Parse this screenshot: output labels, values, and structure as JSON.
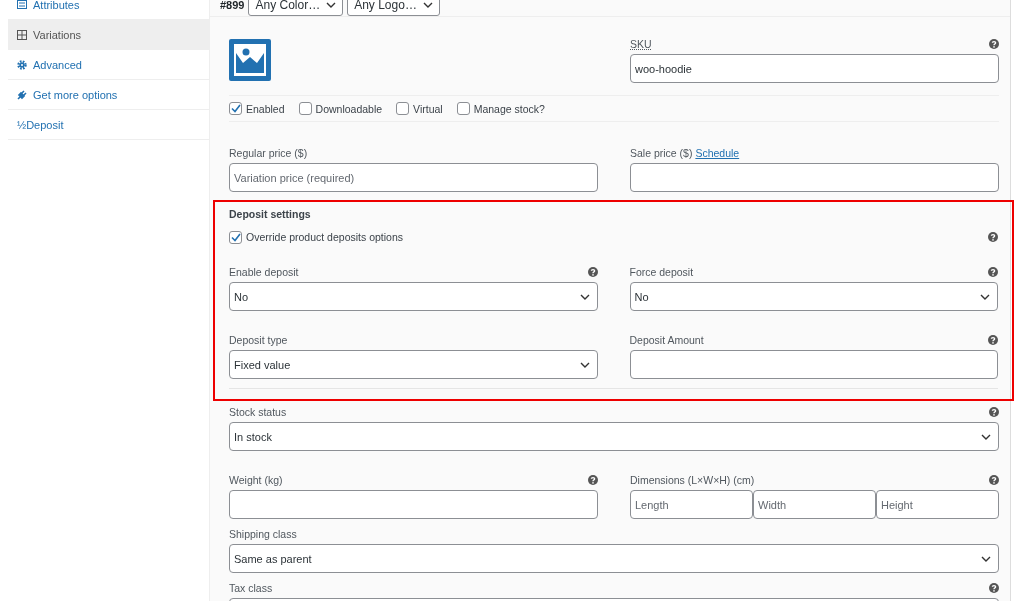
{
  "sidebar": {
    "items": [
      {
        "label": "Attributes",
        "kind": "list",
        "selected": false
      },
      {
        "label": "Variations",
        "kind": "grid",
        "selected": true
      },
      {
        "label": "Advanced",
        "kind": "gear",
        "selected": false
      },
      {
        "label": "Get more options",
        "kind": "plug",
        "selected": false
      },
      {
        "label": "½Deposit",
        "kind": "none",
        "selected": false
      }
    ]
  },
  "variation": {
    "number": "#899",
    "selects": [
      "Any Color…",
      "Any Logo…"
    ],
    "sku": {
      "label": "SKU",
      "value": "woo-hoodie",
      "help": true
    },
    "checkboxes": [
      {
        "label": "Enabled",
        "checked": true
      },
      {
        "label": "Downloadable",
        "checked": false
      },
      {
        "label": "Virtual",
        "checked": false
      },
      {
        "label": "Manage stock?",
        "checked": false
      }
    ],
    "regular_price": {
      "label": "Regular price ($)",
      "placeholder": "Variation price (required)",
      "help": false
    },
    "sale_price": {
      "label": "Sale price ($)",
      "link": "Schedule",
      "help": false
    },
    "deposit": {
      "title": "Deposit settings",
      "override": {
        "label": "Override product deposits options",
        "checked": true,
        "help": true
      },
      "fields": [
        {
          "label": "Enable deposit",
          "kind": "select",
          "value": "No",
          "help": true
        },
        {
          "label": "Force deposit",
          "kind": "select",
          "value": "No",
          "help": true
        },
        {
          "label": "Deposit type",
          "kind": "select",
          "value": "Fixed value",
          "help": false
        },
        {
          "label": "Deposit Amount",
          "kind": "input",
          "help": true
        }
      ]
    },
    "stock_status": {
      "label": "Stock status",
      "kind": "select",
      "value": "In stock",
      "help": true
    },
    "weight": {
      "label": "Weight (kg)",
      "help": true
    },
    "dimensions": {
      "label": "Dimensions (L×W×H) (cm)",
      "placeholders": [
        "Length",
        "Width",
        "Height"
      ],
      "help": true
    },
    "shipping_class": {
      "label": "Shipping class",
      "kind": "select",
      "value": "Same as parent",
      "help": false
    },
    "tax_class": {
      "label": "Tax class",
      "help": true
    }
  }
}
